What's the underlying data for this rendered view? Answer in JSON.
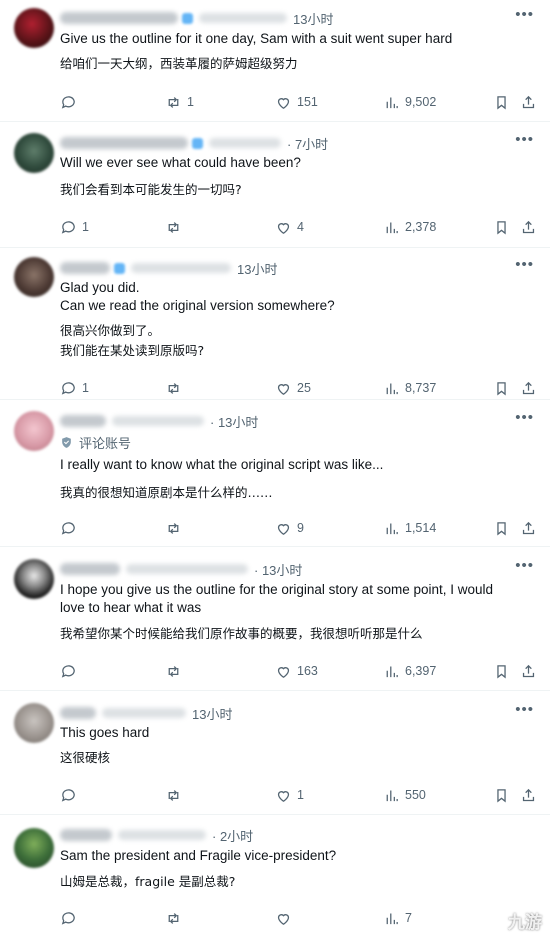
{
  "replies": [
    {
      "time": "13小时",
      "en_lines": [
        "Give us the outline for it one day, Sam with a suit went super hard"
      ],
      "zh_lines": [
        "给咱们一天大纲，西装革履的萨姆超级努力"
      ],
      "replies_count": "",
      "retweets": "1",
      "likes": "151",
      "views": "9,502"
    },
    {
      "time": "· 7小时",
      "en_lines": [
        "Will we ever see what could have been?"
      ],
      "zh_lines": [
        "我们会看到本可能发生的一切吗?"
      ],
      "replies_count": "1",
      "retweets": "",
      "likes": "4",
      "views": "2,378"
    },
    {
      "time": "13小时",
      "en_lines": [
        "Glad you did.",
        "Can we read the original version somewhere?"
      ],
      "zh_lines": [
        "很高兴你做到了。",
        "我们能在某处读到原版吗?"
      ],
      "replies_count": "1",
      "retweets": "",
      "likes": "25",
      "views": "8,737"
    },
    {
      "time": "· 13小时",
      "tag": "评论账号",
      "en_lines": [
        "I really want to know what the original script was like..."
      ],
      "zh_lines": [
        "我真的很想知道原剧本是什么样的……"
      ],
      "replies_count": "",
      "retweets": "",
      "likes": "9",
      "views": "1,514"
    },
    {
      "time": "· 13小时",
      "en_lines": [
        "I hope you give us the outline for the original story at some point, I would",
        "love to hear what it was"
      ],
      "zh_lines": [
        "我希望你某个时候能给我们原作故事的概要，我很想听听那是什么"
      ],
      "replies_count": "",
      "retweets": "",
      "likes": "163",
      "views": "6,397"
    },
    {
      "time": "13小时",
      "en_lines": [
        "This goes hard"
      ],
      "zh_lines": [
        "这很硬核"
      ],
      "replies_count": "",
      "retweets": "",
      "likes": "1",
      "views": "550"
    },
    {
      "time": "· 2小时",
      "en_lines": [
        "Sam the president and Fragile vice-president?"
      ],
      "zh_lines": [
        "山姆是总裁，fragile 是副总裁?"
      ],
      "replies_count": "",
      "retweets": "",
      "likes": "",
      "views": "7"
    }
  ],
  "watermark": "九游",
  "colors": {
    "text": "#0f1419",
    "secondary": "#536471",
    "divider": "#eff3f4",
    "verified": "#1d9bf0"
  },
  "icons": [
    "reply-icon",
    "retweet-icon",
    "like-icon",
    "views-icon",
    "bookmark-icon",
    "share-icon",
    "more-icon",
    "comment-account-icon"
  ]
}
